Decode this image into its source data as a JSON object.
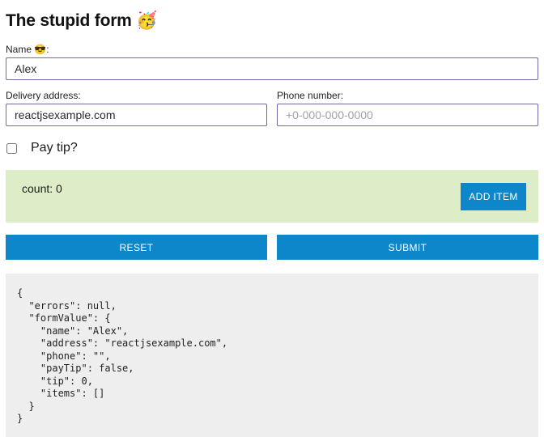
{
  "title": "The stupid form 🥳",
  "fields": {
    "name": {
      "label": "Name 😎:",
      "value": "Alex"
    },
    "address": {
      "label": "Delivery address:",
      "value": "reactjsexample.com"
    },
    "phone": {
      "label": "Phone number:",
      "value": "",
      "placeholder": "+0-000-000-0000"
    }
  },
  "pay_tip": {
    "label": "Pay tip?",
    "checked": false
  },
  "items_panel": {
    "count_label": "count: 0",
    "add_button_label": "ADD ITEM"
  },
  "actions": {
    "reset_label": "RESET",
    "submit_label": "SUBMIT"
  },
  "output_json": "{\n  \"errors\": null,\n  \"formValue\": {\n    \"name\": \"Alex\",\n    \"address\": \"reactjsexample.com\",\n    \"phone\": \"\",\n    \"payTip\": false,\n    \"tip\": 0,\n    \"items\": []\n  }\n}",
  "colors": {
    "accent_blue": "#0d87c9",
    "panel_green": "#dcedc8",
    "input_border_purple": "#7668a0",
    "code_background": "#eeeeee"
  }
}
